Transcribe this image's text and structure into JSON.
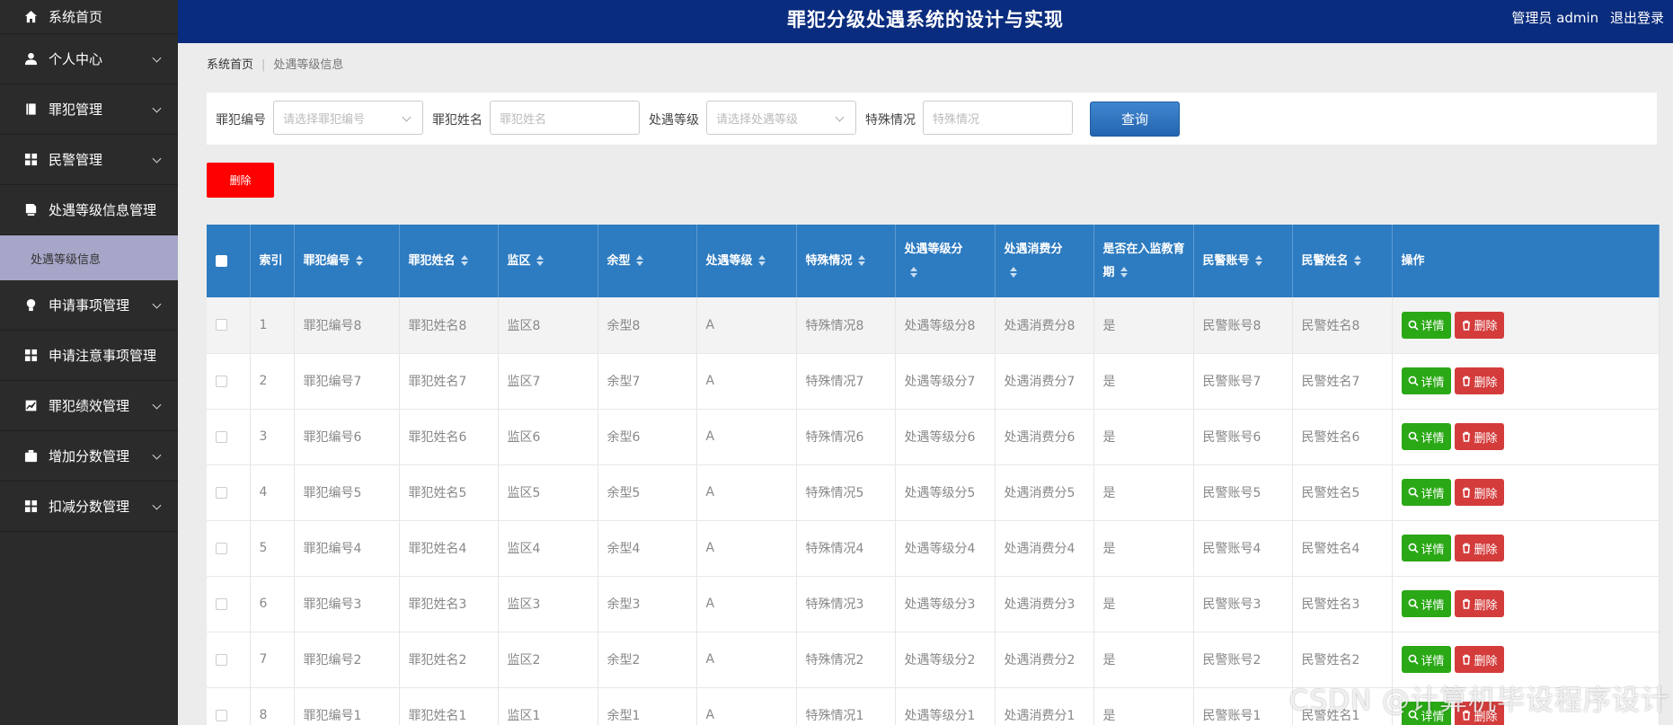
{
  "app": {
    "title": "罪犯分级处遇系统的设计与实现",
    "user_label": "管理员 admin",
    "logout_label": "退出登录"
  },
  "sidebar": {
    "items": [
      {
        "label": "系统首页",
        "icon": "home-icon",
        "chevron": false
      },
      {
        "label": "个人中心",
        "icon": "person-icon",
        "chevron": true
      },
      {
        "label": "罪犯管理",
        "icon": "book-icon",
        "chevron": true
      },
      {
        "label": "民警管理",
        "icon": "grid-icon",
        "chevron": true
      },
      {
        "label": "处遇等级信息管理",
        "icon": "document-icon",
        "chevron": false
      },
      {
        "label": "处遇等级信息",
        "icon": "",
        "chevron": false,
        "submenu": true
      },
      {
        "label": "申请事项管理",
        "icon": "bulb-icon",
        "chevron": true
      },
      {
        "label": "申请注意事项管理",
        "icon": "grid-icon",
        "chevron": false
      },
      {
        "label": "罪犯绩效管理",
        "icon": "chart-icon",
        "chevron": true
      },
      {
        "label": "增加分数管理",
        "icon": "briefcase-icon",
        "chevron": true
      },
      {
        "label": "扣减分数管理",
        "icon": "grid-icon",
        "chevron": true
      }
    ]
  },
  "breadcrumb": {
    "home": "系统首页",
    "current": "处遇等级信息"
  },
  "search": {
    "f1_label": "罪犯编号",
    "f1_placeholder": "请选择罪犯编号",
    "f2_label": "罪犯姓名",
    "f2_placeholder": "罪犯姓名",
    "f3_label": "处遇等级",
    "f3_placeholder": "请选择处遇等级",
    "f4_label": "特殊情况",
    "f4_placeholder": "特殊情况",
    "button": "查询"
  },
  "actions": {
    "batch_delete": "删除"
  },
  "table": {
    "headers": [
      "索引",
      "罪犯编号",
      "罪犯姓名",
      "监区",
      "余型",
      "处遇等级",
      "特殊情况",
      "处遇等级分",
      "处遇消费分",
      "是否在入监教育期",
      "民警账号",
      "民警姓名",
      "操作"
    ],
    "detail_label": "详情",
    "delete_label": "删除",
    "rows": [
      [
        "1",
        "罪犯编号8",
        "罪犯姓名8",
        "监区8",
        "余型8",
        "A",
        "特殊情况8",
        "处遇等级分8",
        "处遇消费分8",
        "是",
        "民警账号8",
        "民警姓名8"
      ],
      [
        "2",
        "罪犯编号7",
        "罪犯姓名7",
        "监区7",
        "余型7",
        "A",
        "特殊情况7",
        "处遇等级分7",
        "处遇消费分7",
        "是",
        "民警账号7",
        "民警姓名7"
      ],
      [
        "3",
        "罪犯编号6",
        "罪犯姓名6",
        "监区6",
        "余型6",
        "A",
        "特殊情况6",
        "处遇等级分6",
        "处遇消费分6",
        "是",
        "民警账号6",
        "民警姓名6"
      ],
      [
        "4",
        "罪犯编号5",
        "罪犯姓名5",
        "监区5",
        "余型5",
        "A",
        "特殊情况5",
        "处遇等级分5",
        "处遇消费分5",
        "是",
        "民警账号5",
        "民警姓名5"
      ],
      [
        "5",
        "罪犯编号4",
        "罪犯姓名4",
        "监区4",
        "余型4",
        "A",
        "特殊情况4",
        "处遇等级分4",
        "处遇消费分4",
        "是",
        "民警账号4",
        "民警姓名4"
      ],
      [
        "6",
        "罪犯编号3",
        "罪犯姓名3",
        "监区3",
        "余型3",
        "A",
        "特殊情况3",
        "处遇等级分3",
        "处遇消费分3",
        "是",
        "民警账号3",
        "民警姓名3"
      ],
      [
        "7",
        "罪犯编号2",
        "罪犯姓名2",
        "监区2",
        "余型2",
        "A",
        "特殊情况2",
        "处遇等级分2",
        "处遇消费分2",
        "是",
        "民警账号2",
        "民警姓名2"
      ],
      [
        "8",
        "罪犯编号1",
        "罪犯姓名1",
        "监区1",
        "余型1",
        "A",
        "特殊情况1",
        "处遇等级分1",
        "处遇消费分1",
        "是",
        "民警账号1",
        "民警姓名1"
      ]
    ]
  },
  "watermark": "CSDN @计算机毕设程序设计",
  "colors": {
    "header_bg": "#0a2c7e",
    "sidebar_bg": "#2b2b2b",
    "table_header_bg": "#2d7bc0",
    "detail_button": "#2aa815",
    "delete_button": "#d43c3c",
    "batch_delete_button": "#ff0000"
  }
}
